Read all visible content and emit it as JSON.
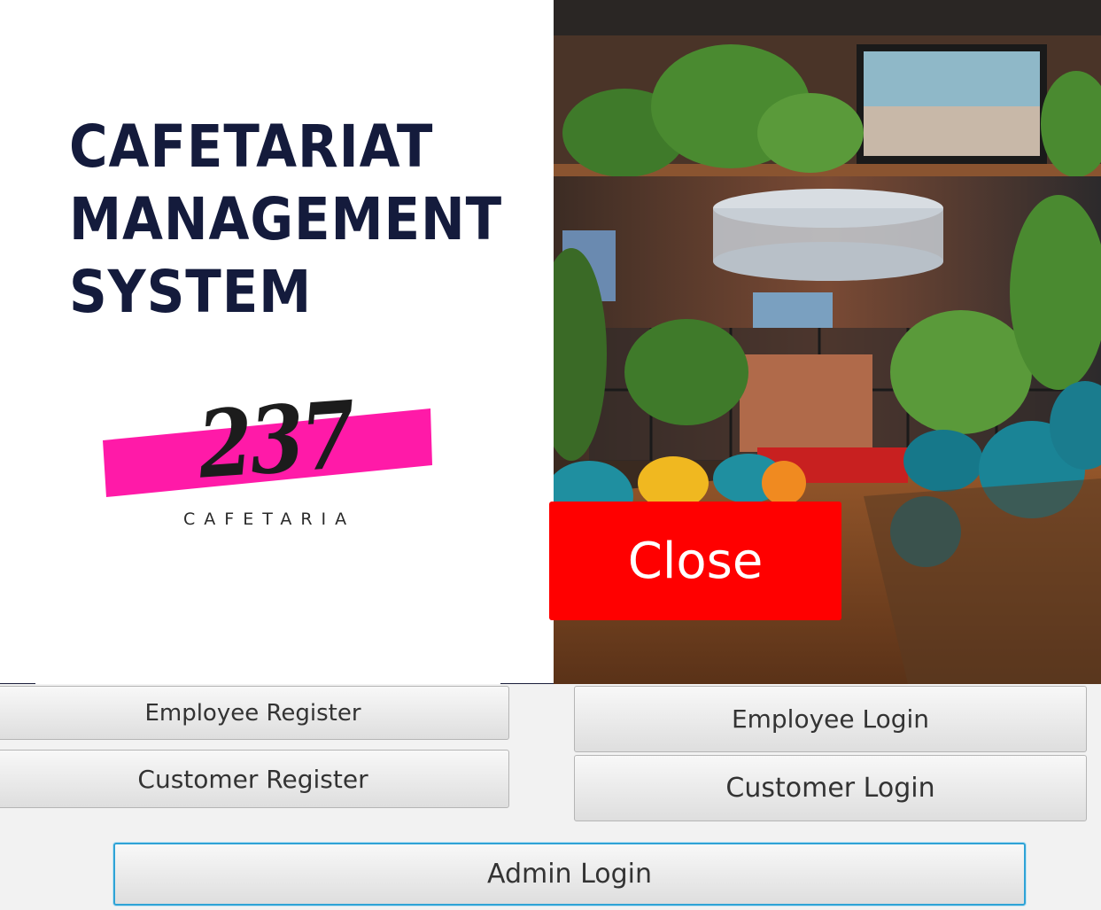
{
  "header": {
    "title_lines": [
      "CAFETARIAT",
      "MANAGEMENT",
      "SYSTEM"
    ]
  },
  "logo": {
    "number": "237",
    "word": "CAFETARIA",
    "stripe_color": "#ff1aa8"
  },
  "photo": {
    "description_icon": "restaurant-interior-photo"
  },
  "buttons": {
    "close": "Close",
    "employee_register": "Employee Register",
    "customer_register": "Customer Register",
    "employee_login": "Employee Login",
    "customer_login": "Customer Login",
    "admin_login": "Admin Login"
  },
  "colors": {
    "title": "#141b3c",
    "close_bg": "#ff0000",
    "focus_border": "#2fa3d6"
  }
}
